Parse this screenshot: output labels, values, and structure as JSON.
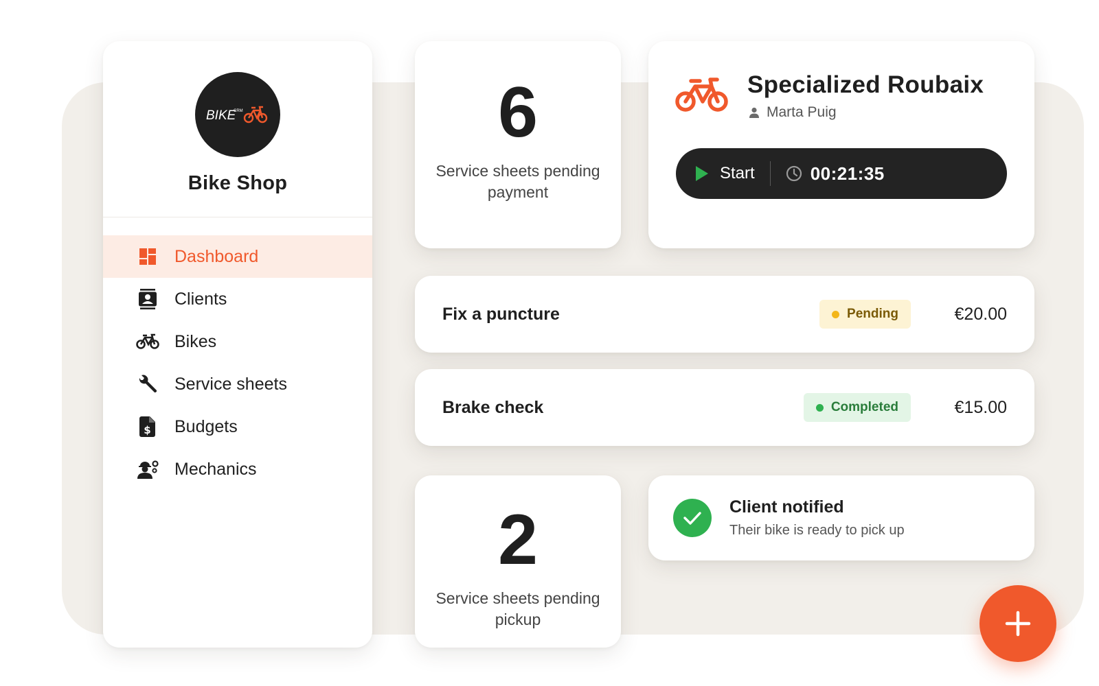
{
  "brand": {
    "logo_text": "BIKE",
    "logo_badge": "CRM",
    "shop_name": "Bike Shop",
    "accent": "#f0592c"
  },
  "sidebar": {
    "items": [
      {
        "label": "Dashboard",
        "icon": "dashboard-icon",
        "active": true
      },
      {
        "label": "Clients",
        "icon": "contact-card-icon",
        "active": false
      },
      {
        "label": "Bikes",
        "icon": "bicycle-icon",
        "active": false
      },
      {
        "label": "Service sheets",
        "icon": "wrench-icon",
        "active": false
      },
      {
        "label": "Budgets",
        "icon": "invoice-dollar-icon",
        "active": false
      },
      {
        "label": "Mechanics",
        "icon": "mechanic-icon",
        "active": false
      }
    ]
  },
  "stats": {
    "pending_payment": {
      "value": "6",
      "label": "Service sheets pending payment"
    },
    "pending_pickup": {
      "value": "2",
      "label": "Service sheets pending pickup"
    }
  },
  "bike": {
    "name": "Specialized Roubaix",
    "owner": "Marta Puig",
    "start_label": "Start",
    "timer": "00:21:35"
  },
  "services": [
    {
      "name": "Fix a puncture",
      "status": "Pending",
      "price": "€20.00"
    },
    {
      "name": "Brake check",
      "status": "Completed",
      "price": "€15.00"
    }
  ],
  "notification": {
    "title": "Client notified",
    "subtitle": "Their bike is ready to pick up"
  },
  "fab": {
    "icon": "plus-icon"
  }
}
